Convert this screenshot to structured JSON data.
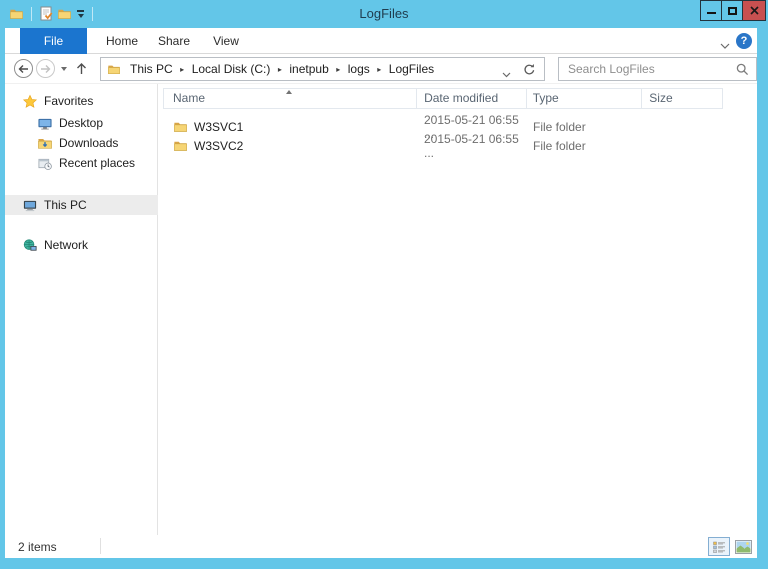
{
  "window": {
    "title": "LogFiles"
  },
  "ribbon": {
    "tabs": [
      "File",
      "Home",
      "Share",
      "View"
    ],
    "active_tab": "File"
  },
  "address_bar": {
    "breadcrumb": [
      "This PC",
      "Local Disk (C:)",
      "inetpub",
      "logs",
      "LogFiles"
    ]
  },
  "search": {
    "placeholder": "Search LogFiles"
  },
  "sidebar": {
    "items": [
      {
        "label": "Favorites"
      },
      {
        "label": "Desktop"
      },
      {
        "label": "Downloads"
      },
      {
        "label": "Recent places"
      },
      {
        "label": "This PC"
      },
      {
        "label": "Network"
      }
    ],
    "selected": "This PC"
  },
  "file_list": {
    "columns": [
      "Name",
      "Date modified",
      "Type",
      "Size"
    ],
    "sort": {
      "column": "Name",
      "direction": "ascending"
    },
    "rows": [
      {
        "name": "W3SVC1",
        "date_modified": "2015-05-21 06:55 ...",
        "type": "File folder",
        "size": ""
      },
      {
        "name": "W3SVC2",
        "date_modified": "2015-05-21 06:55 ...",
        "type": "File folder",
        "size": ""
      }
    ]
  },
  "status_bar": {
    "items_text": "2 items"
  },
  "icons": {
    "help": "?"
  },
  "colors": {
    "titlebar": "#63c6e8",
    "active_tab": "#1b75cf",
    "close_button": "#c75050",
    "help_button": "#2a76c8",
    "folder_yellow": "#f6d575",
    "sidebar_selection": "#ececec"
  }
}
